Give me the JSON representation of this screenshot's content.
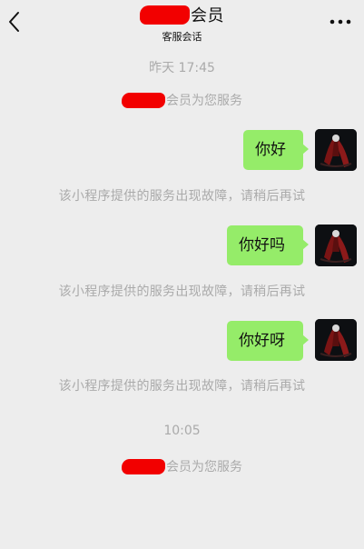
{
  "header": {
    "title_suffix": "会员",
    "subtitle": "客服会话",
    "back_icon": "chevron-left-icon",
    "more_icon": "ellipsis-icon"
  },
  "chat": {
    "timestamp_1": "昨天 17:45",
    "service_line_1": "会员为您服务",
    "messages": [
      {
        "text": "你好",
        "notice": "该小程序提供的服务出现故障，请稍后再试"
      },
      {
        "text": "你好吗",
        "notice": "该小程序提供的服务出现故障，请稍后再试"
      },
      {
        "text": "你好呀",
        "notice": "该小程序提供的服务出现故障，请稍后再试"
      }
    ],
    "timestamp_2": "10:05",
    "service_line_2": "会员为您服务"
  },
  "colors": {
    "background": "#ededed",
    "bubble": "#95ec69",
    "redaction": "#f20000",
    "system_text": "#aaaaaa"
  }
}
